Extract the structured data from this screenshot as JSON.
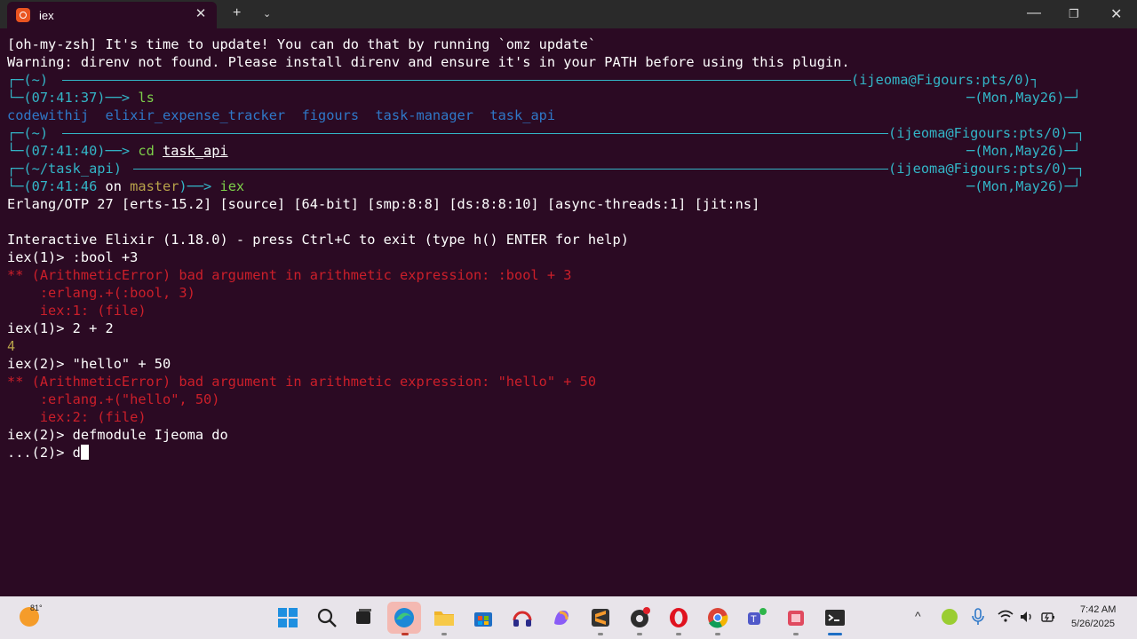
{
  "window": {
    "tab_title": "iex",
    "close_glyph": "✕",
    "new_tab_glyph": "+",
    "dropdown_glyph": "⌄",
    "min_glyph": "—",
    "max_glyph": "❐",
    "win_close_glyph": "✕"
  },
  "terminal": {
    "line1": "[oh-my-zsh] It's time to update! You can do that by running `omz update`",
    "line2": "Warning: direnv not found. Please install direnv and ensure it's in your PATH before using this plugin.",
    "p1": {
      "dir": "┌─(~)",
      "user": "(ijeoma@Figours:pts/0)┐",
      "time": "└─(07:41:37)──> ",
      "cmd": "ls",
      "date": "─(Mon,May26)─┘"
    },
    "ls_out": [
      "codewithij",
      "elixir_expense_tracker",
      "figours",
      "task-manager",
      "task_api"
    ],
    "p2": {
      "dir": "┌─(~)",
      "user": "(ijeoma@Figours:pts/0)─┐",
      "time": "└─(07:41:40)──> ",
      "cmd": "cd ",
      "arg": "task_api",
      "date": "─(Mon,May26)─┘"
    },
    "p3": {
      "dir": "┌─(~/task_api)",
      "user": "(ijeoma@Figours:pts/0)─┐",
      "time": "└─(07:41:46 ",
      "on": "on ",
      "branch": "master",
      "arrow": ")──> ",
      "cmd": "iex",
      "date": "─(Mon,May26)─┘"
    },
    "erlang": "Erlang/OTP 27 [erts-15.2] [source] [64-bit] [smp:8:8] [ds:8:8:10] [async-threads:1] [jit:ns]",
    "banner": "Interactive Elixir (1.18.0) - press Ctrl+C to exit (type h() ENTER for help)",
    "l_iex1": "iex(1)> :bool +3",
    "l_err1": "** (ArithmeticError) bad argument in arithmetic expression: :bool + 3",
    "l_err1b": "    :erlang.+(:bool, 3)",
    "l_err1c": "    iex:1: (file)",
    "l_iex2": "iex(1)> 2 + 2",
    "l_res2": "4",
    "l_iex3": "iex(2)> \"hello\" + 50",
    "l_err2": "** (ArithmeticError) bad argument in arithmetic expression: \"hello\" + 50",
    "l_err2b": "    :erlang.+(\"hello\", 50)",
    "l_err2c": "    iex:2: (file)",
    "l_iex4": "iex(2)> defmodule Ijeoma do",
    "l_cont": "...(2)> d"
  },
  "taskbar": {
    "temp": "81°",
    "time": "7:42 AM",
    "date": "5/26/2025",
    "tray_chevron": "^",
    "icons": [
      "start-icon",
      "search-icon",
      "task-view-icon",
      "edge-icon",
      "file-explorer-icon",
      "store-icon",
      "headphones-app-icon",
      "copilot-icon",
      "sublime-icon",
      "app-icon",
      "opera-icon",
      "chrome-icon",
      "teams-icon",
      "stack-app-icon",
      "terminal-icon"
    ]
  },
  "colors": {
    "terminal_bg": "#2b0a23",
    "cyan": "#33b5c7",
    "error_red": "#cc1f2a",
    "ls_blue": "#2f78c8",
    "accent_orange": "#e95420"
  }
}
